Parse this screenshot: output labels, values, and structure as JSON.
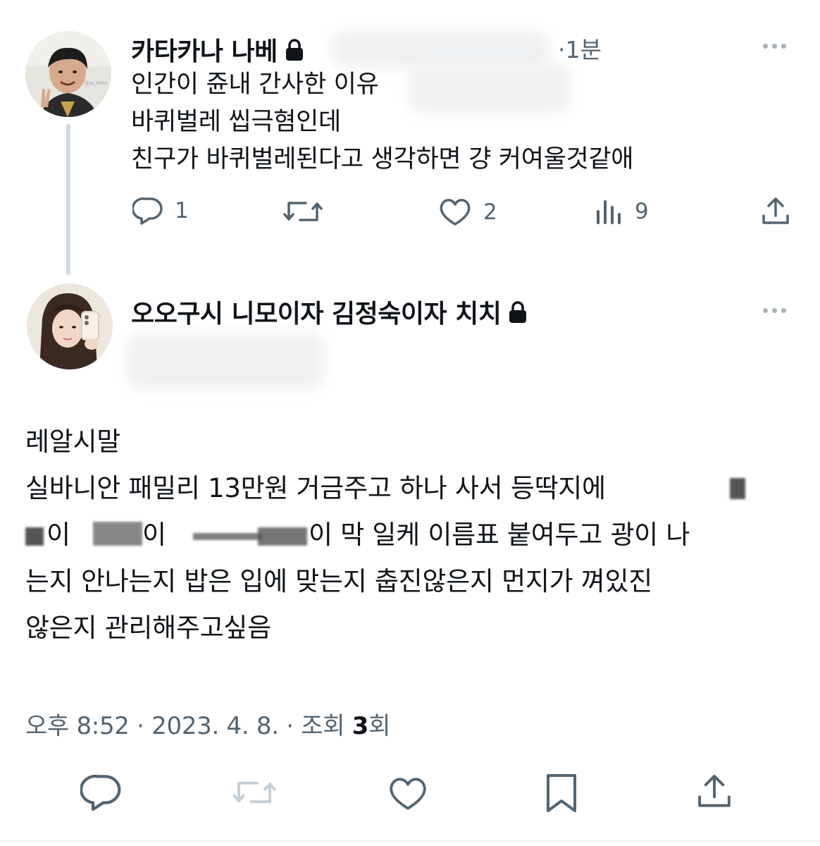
{
  "reply_tweet": {
    "display_name": "카타카나 나베",
    "time": "·1분",
    "lines": [
      "인간이 쥰내 간사한 이유",
      "바퀴벌레 씹극혐인데",
      "친구가 바퀴벌레된다고 생각하면 걍 커여울것같애"
    ],
    "avatar_watermark": "@ai_kkkk",
    "stats": {
      "replies": "1",
      "likes": "2",
      "views": "9"
    },
    "icons": [
      "lock-icon",
      "more-icon",
      "reply-icon",
      "retweet-icon",
      "like-icon",
      "views-icon",
      "share-icon"
    ]
  },
  "main_tweet": {
    "display_name": "오오구시 니모이자 김정숙이자 치치",
    "lines": [
      "레알시말",
      "실바니안 패밀리 13만원 거금주고 하나 사서 등딱지에",
      "이  이  이 막 일케 이름표 붙여두고 광이 나",
      "는지 안나는지 밥은 입에 맞는지 춥진않은지 먼지가 껴있진",
      "않은지 관리해주고싶음"
    ],
    "line3_parts": [
      "이",
      "이",
      "이 막 일케 이름표 붙여두고 광이 나"
    ],
    "meta": {
      "time": "오후 8:52",
      "sep": "·",
      "date": "2023. 4. 8.",
      "views_label": "조회",
      "views_count": "3",
      "views_unit": "회"
    },
    "icons": [
      "lock-icon",
      "more-icon",
      "reply-icon",
      "retweet-icon",
      "like-icon",
      "bookmark-icon",
      "share-icon"
    ]
  },
  "colors": {
    "text": "#0f1419",
    "muted": "#536471",
    "thread_line": "#cfd9de",
    "disabled_icon": "#c4cfd6"
  }
}
